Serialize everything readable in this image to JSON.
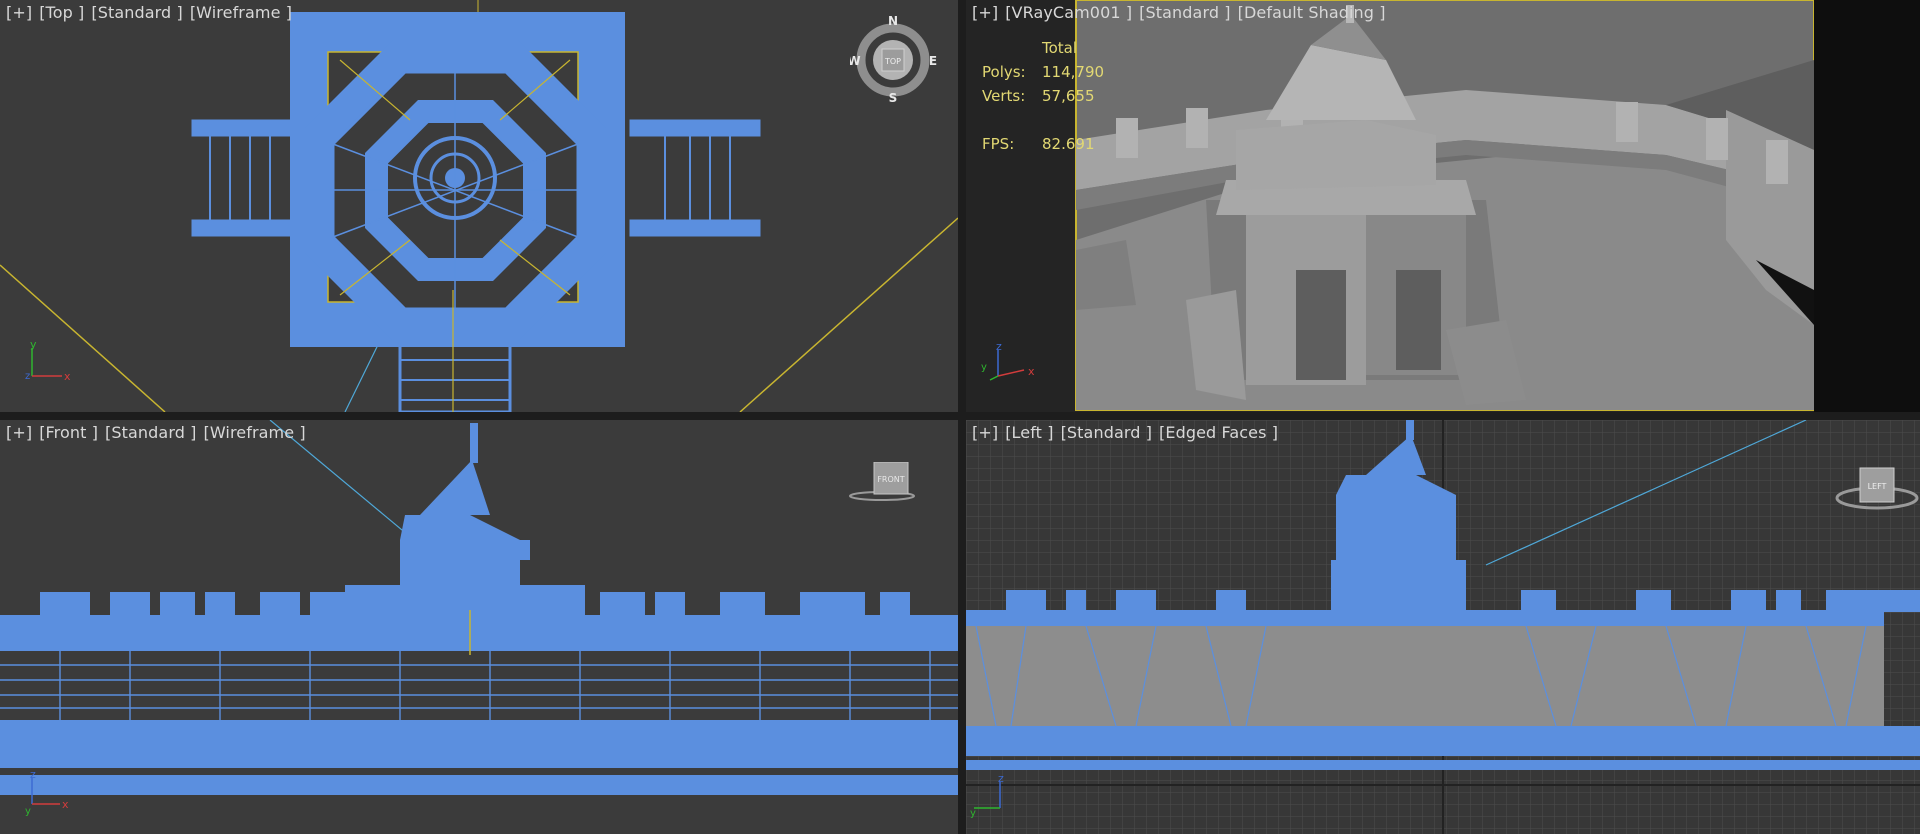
{
  "viewports": {
    "top": {
      "label": {
        "plus": "[+]",
        "view": "[Top ]",
        "preset": "[Standard ]",
        "mode": "[Wireframe ]"
      },
      "compass": {
        "n": "N",
        "s": "S",
        "e": "E",
        "w": "W",
        "cube": "TOP"
      }
    },
    "camera": {
      "label": {
        "plus": "[+]",
        "view": "[VRayCam001 ]",
        "preset": "[Standard ]",
        "mode": "[Default Shading ]"
      },
      "stats": {
        "header": "Total",
        "polys_label": "Polys:",
        "polys_value": "114,790",
        "verts_label": "Verts:",
        "verts_value": "57,655",
        "fps_label": "FPS:",
        "fps_value": "82.691"
      }
    },
    "front": {
      "label": {
        "plus": "[+]",
        "view": "[Front ]",
        "preset": "[Standard ]",
        "mode": "[Wireframe ]"
      },
      "cube": "FRONT"
    },
    "left": {
      "label": {
        "plus": "[+]",
        "view": "[Left ]",
        "preset": "[Standard ]",
        "mode": "[Edged Faces ]"
      },
      "cube": "LEFT"
    }
  },
  "axes": {
    "x": "x",
    "y": "y",
    "z": "z"
  },
  "colors": {
    "wire": "#5b8fdf",
    "grid": "#4a4a4a",
    "safe_frame": "#c8b530",
    "camera_line": "#4fa8d8",
    "stats_text": "#e2d873"
  }
}
